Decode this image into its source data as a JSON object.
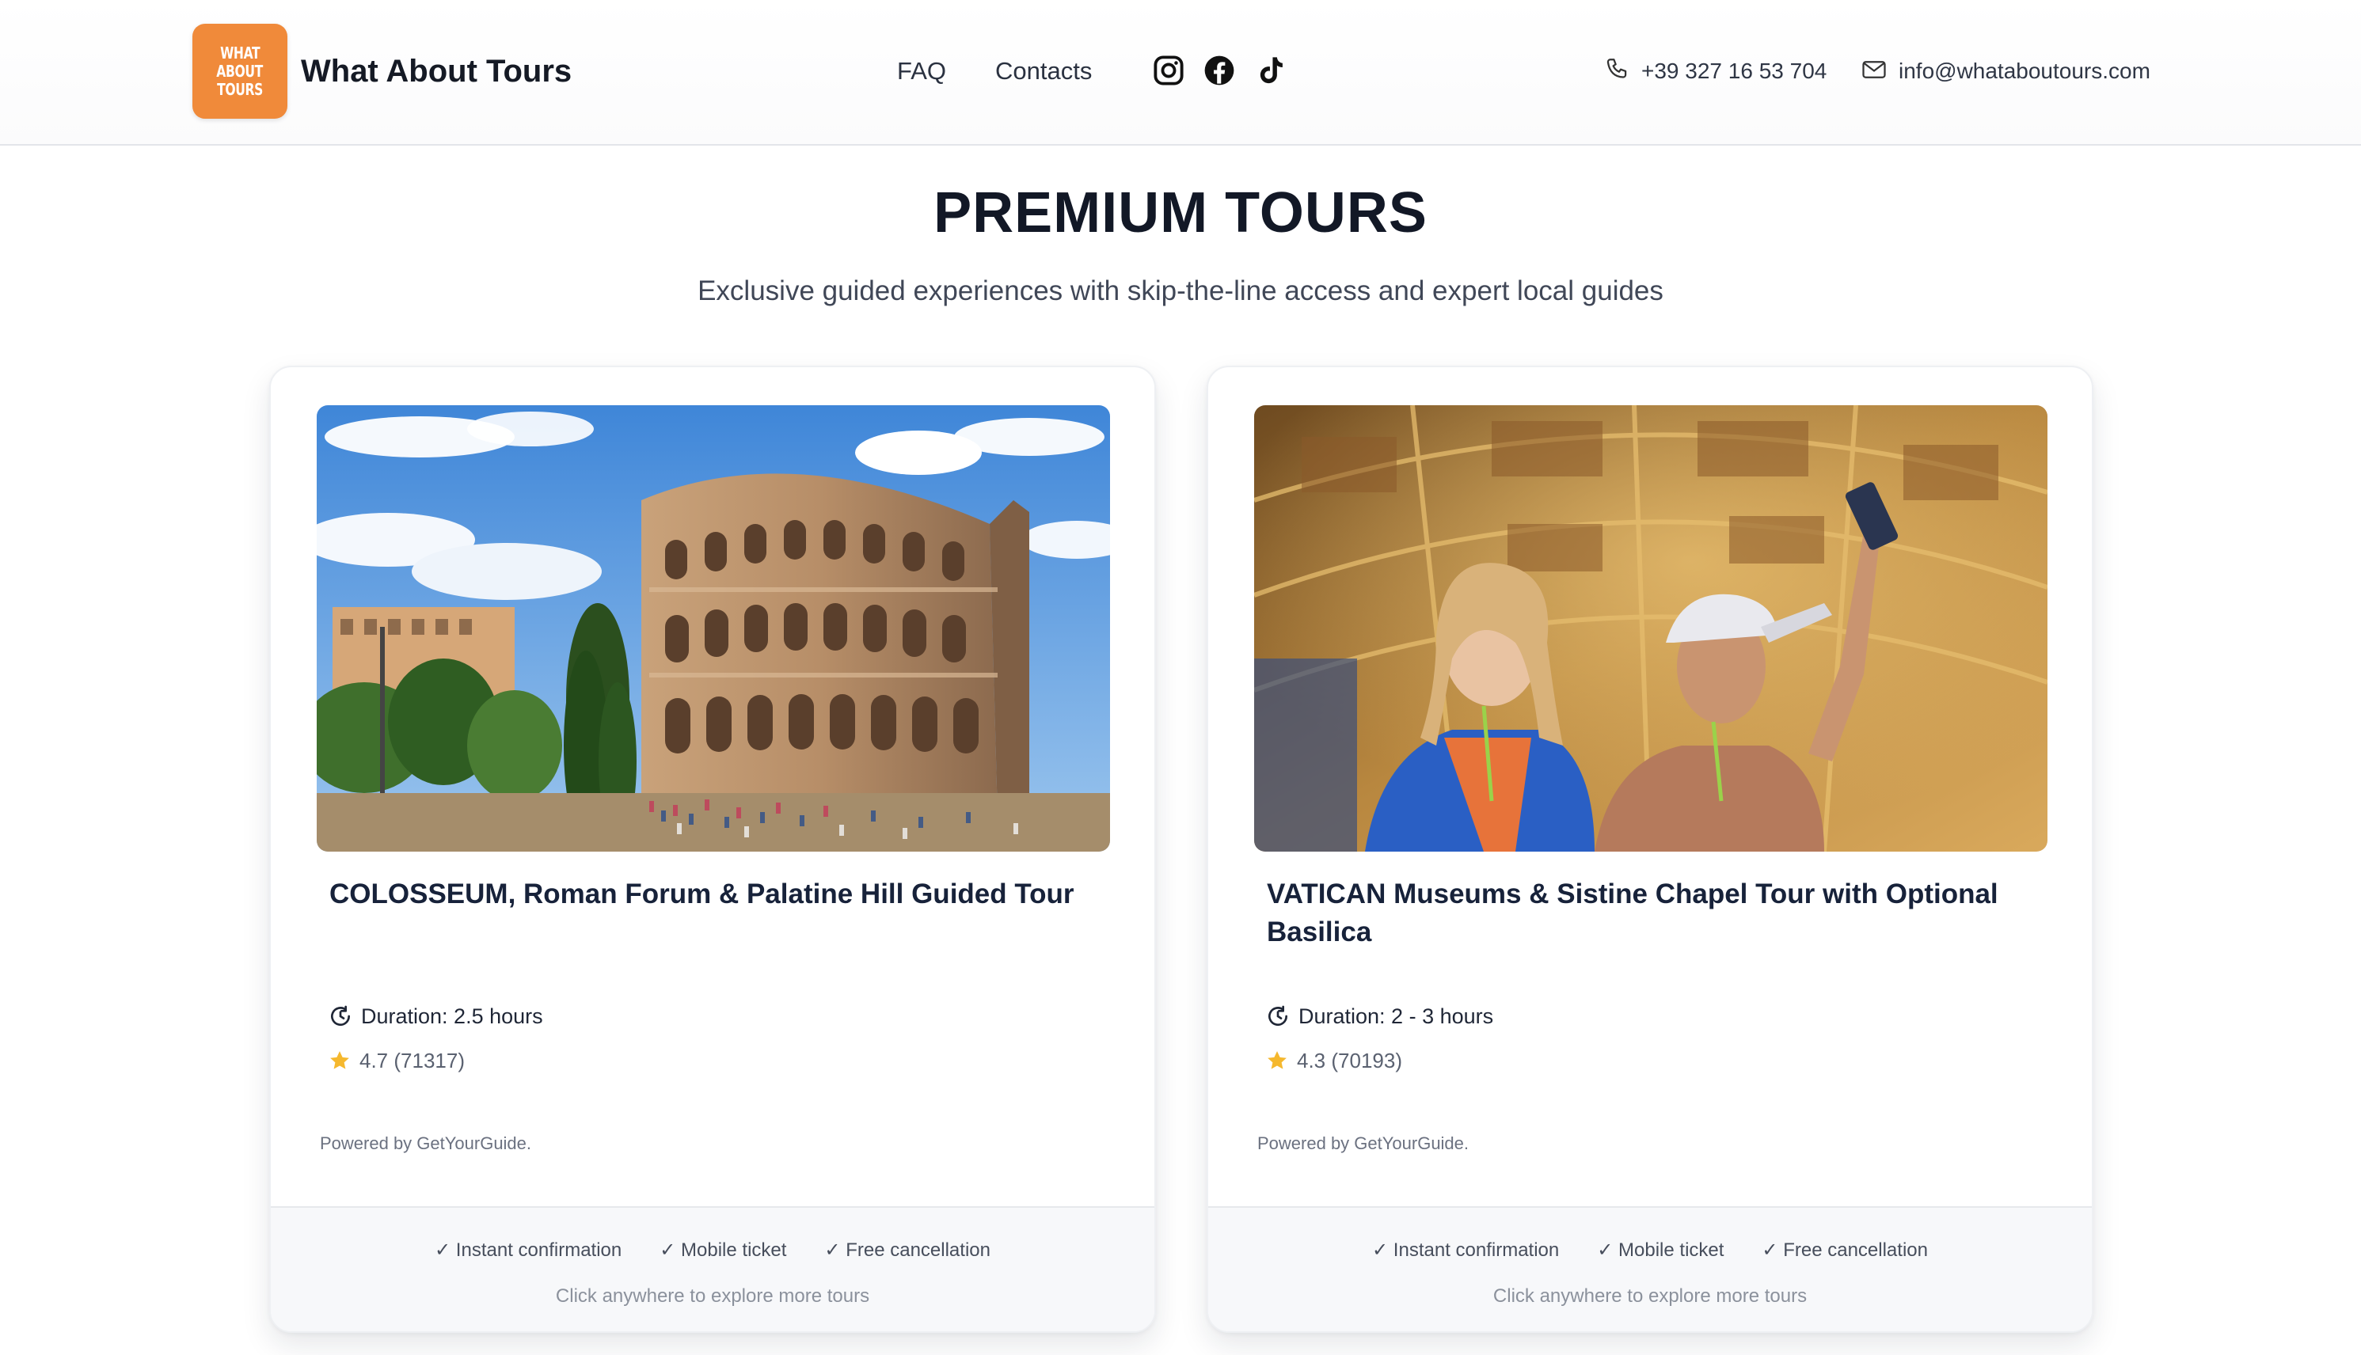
{
  "header": {
    "logo_lines": [
      "WHAT",
      "ABOUT",
      "TOURS"
    ],
    "brand": "What About Tours",
    "nav": [
      {
        "label": "FAQ"
      },
      {
        "label": "Contacts"
      }
    ],
    "social_icons": [
      "instagram-icon",
      "facebook-icon",
      "tiktok-icon"
    ],
    "phone": "+39 327 16 53 704",
    "email": "info@whataboutours.com",
    "brand_color": "#f08a3a"
  },
  "hero": {
    "title": "PREMIUM TOURS",
    "subtitle": "Exclusive guided experiences with skip-the-line access and expert local guides"
  },
  "tours": [
    {
      "title": "COLOSSEUM, Roman Forum & Palatine Hill Guided Tour",
      "duration": "Duration: 2.5 hours",
      "rating": "4.7 (71317)",
      "powered_by": "Powered by GetYourGuide.",
      "features": [
        "✓ Instant confirmation",
        "✓ Mobile ticket",
        "✓ Free cancellation"
      ],
      "cta": "Click anywhere to explore more tours",
      "image": "colosseum-photo"
    },
    {
      "title": "VATICAN Museums & Sistine Chapel Tour with Optional Basilica",
      "duration": "Duration: 2 - 3 hours",
      "rating": "4.3 (70193)",
      "powered_by": "Powered by GetYourGuide.",
      "features": [
        "✓ Instant confirmation",
        "✓ Mobile ticket",
        "✓ Free cancellation"
      ],
      "cta": "Click anywhere to explore more tours",
      "image": "vatican-gallery-photo"
    }
  ],
  "colors": {
    "star": "#f5b82e",
    "text_dark": "#121826",
    "footer_bg": "#f7f8fa"
  }
}
